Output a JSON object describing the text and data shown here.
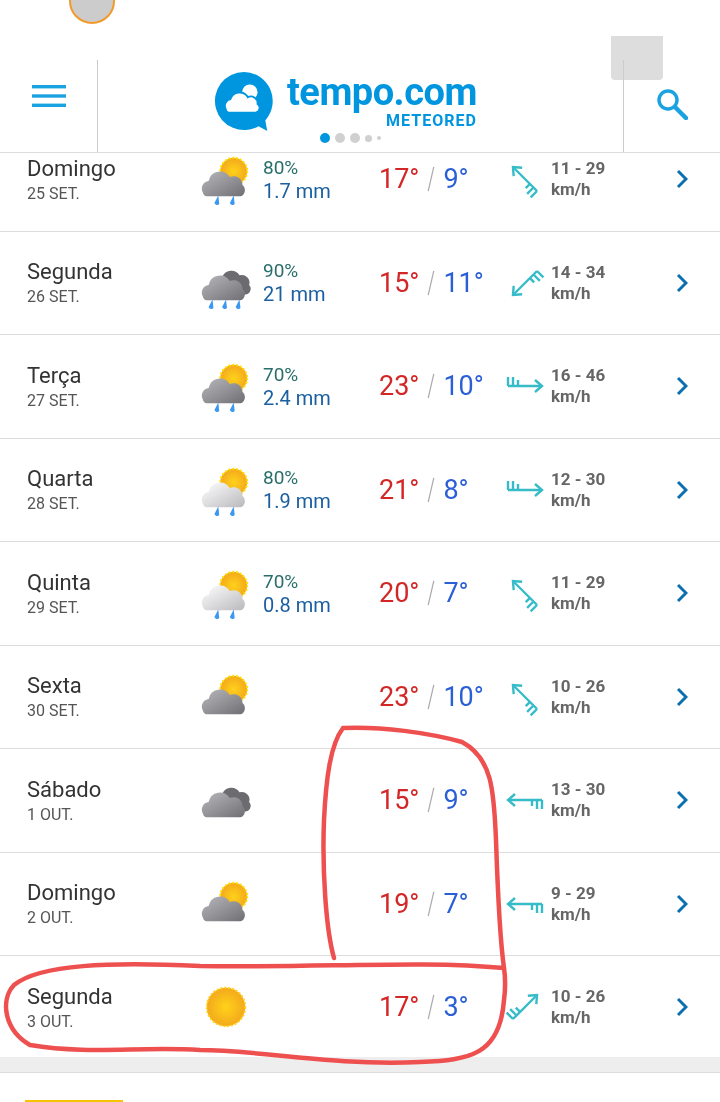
{
  "header": {
    "logo_text": "tempo.com",
    "logo_subtext": "METEORED",
    "page_dots": [
      {
        "selected": true
      },
      {
        "selected": false
      },
      {
        "selected": false
      },
      {
        "selected": false
      },
      {
        "selected": false
      }
    ]
  },
  "days": [
    {
      "day": "Domingo",
      "date": "25 SET.",
      "kind": "sun-cloud-rain",
      "rain_chance": "80%",
      "rain_amount": "1.7 mm",
      "high": "17°",
      "low": "9°",
      "wind": {
        "kind": "nw",
        "speed": "11 - 29",
        "unit": "km/h"
      }
    },
    {
      "day": "Segunda",
      "date": "26 SET.",
      "kind": "cloud-rain",
      "rain_chance": "90%",
      "rain_amount": "21 mm",
      "high": "15°",
      "low": "11°",
      "wind": {
        "kind": "sw",
        "speed": "14 - 34",
        "unit": "km/h"
      }
    },
    {
      "day": "Terça",
      "date": "27 SET.",
      "kind": "sun-cloud-rain",
      "rain_chance": "70%",
      "rain_amount": "2.4 mm",
      "high": "23°",
      "low": "10°",
      "wind": {
        "kind": "e",
        "speed": "16 - 46",
        "unit": "km/h"
      }
    },
    {
      "day": "Quarta",
      "date": "28 SET.",
      "kind": "sun-light-cloud-rain",
      "rain_chance": "80%",
      "rain_amount": "1.9 mm",
      "high": "21°",
      "low": "8°",
      "wind": {
        "kind": "e",
        "speed": "12 - 30",
        "unit": "km/h"
      }
    },
    {
      "day": "Quinta",
      "date": "29 SET.",
      "kind": "sun-light-cloud-rain",
      "rain_chance": "70%",
      "rain_amount": "0.8 mm",
      "high": "20°",
      "low": "7°",
      "wind": {
        "kind": "nw",
        "speed": "11 - 29",
        "unit": "km/h"
      }
    },
    {
      "day": "Sexta",
      "date": "30 SET.",
      "kind": "sun-cloud",
      "high": "23°",
      "low": "10°",
      "wind": {
        "kind": "nw",
        "speed": "10 - 26",
        "unit": "km/h"
      }
    },
    {
      "day": "Sábado",
      "date": "1 OUT.",
      "kind": "cloud",
      "high": "15°",
      "low": "9°",
      "wind": {
        "kind": "w",
        "speed": "13 - 30",
        "unit": "km/h"
      }
    },
    {
      "day": "Domingo",
      "date": "2 OUT.",
      "kind": "sun-cloud",
      "high": "19°",
      "low": "7°",
      "wind": {
        "kind": "w",
        "speed": "9 - 29",
        "unit": "km/h"
      }
    },
    {
      "day": "Segunda",
      "date": "3 OUT.",
      "kind": "sun",
      "high": "17°",
      "low": "3°",
      "wind": {
        "kind": "ne",
        "speed": "10 - 26",
        "unit": "km/h"
      }
    }
  ]
}
